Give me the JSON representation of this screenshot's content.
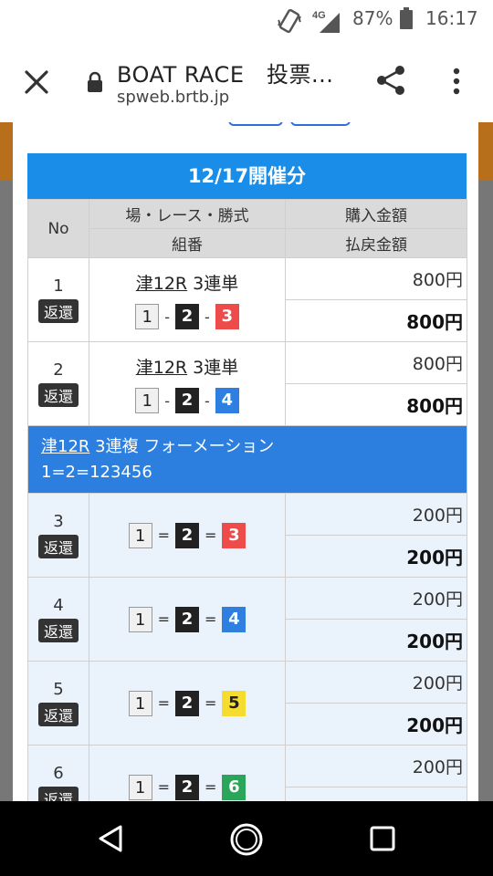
{
  "status_bar": {
    "network": "4G",
    "battery": "87%",
    "time": "16:17"
  },
  "browser": {
    "title": "BOAT RACE　投票...",
    "url": "spweb.brtb.jp"
  },
  "modal": {
    "date_header": "12/17開催分",
    "headers": {
      "no": "No",
      "race_type": "場・レース・勝式",
      "combo": "組番",
      "purchase": "購入金額",
      "payout": "払戻金額"
    },
    "refund_label": "返還",
    "rows_single": [
      {
        "no": "1",
        "race": "津12R",
        "bet_type": "3連単",
        "combo": [
          "1",
          "2",
          "3"
        ],
        "sep": "-",
        "purchase": "800円",
        "payout": "800円"
      },
      {
        "no": "2",
        "race": "津12R",
        "bet_type": "3連単",
        "combo": [
          "1",
          "2",
          "4"
        ],
        "sep": "-",
        "purchase": "800円",
        "payout": "800円"
      }
    ],
    "formation": {
      "race": "津12R",
      "title": "3連複 フォーメーション",
      "combo_text": "1=2=123456"
    },
    "rows_formation": [
      {
        "no": "3",
        "combo": [
          "1",
          "2",
          "3"
        ],
        "sep": "=",
        "purchase": "200円",
        "payout": "200円"
      },
      {
        "no": "4",
        "combo": [
          "1",
          "2",
          "4"
        ],
        "sep": "=",
        "purchase": "200円",
        "payout": "200円"
      },
      {
        "no": "5",
        "combo": [
          "1",
          "2",
          "5"
        ],
        "sep": "=",
        "purchase": "200円",
        "payout": "200円"
      },
      {
        "no": "6",
        "combo": [
          "1",
          "2",
          "6"
        ],
        "sep": "=",
        "purchase": "200円",
        "payout": "200円"
      }
    ]
  },
  "colors": {
    "header_blue": "#1a8de8",
    "formation_blue": "#2d7fdf",
    "boat_3": "#ee4b4b",
    "boat_4": "#2f7fe0",
    "boat_5": "#f6dc2f",
    "boat_6": "#2aa55a"
  }
}
